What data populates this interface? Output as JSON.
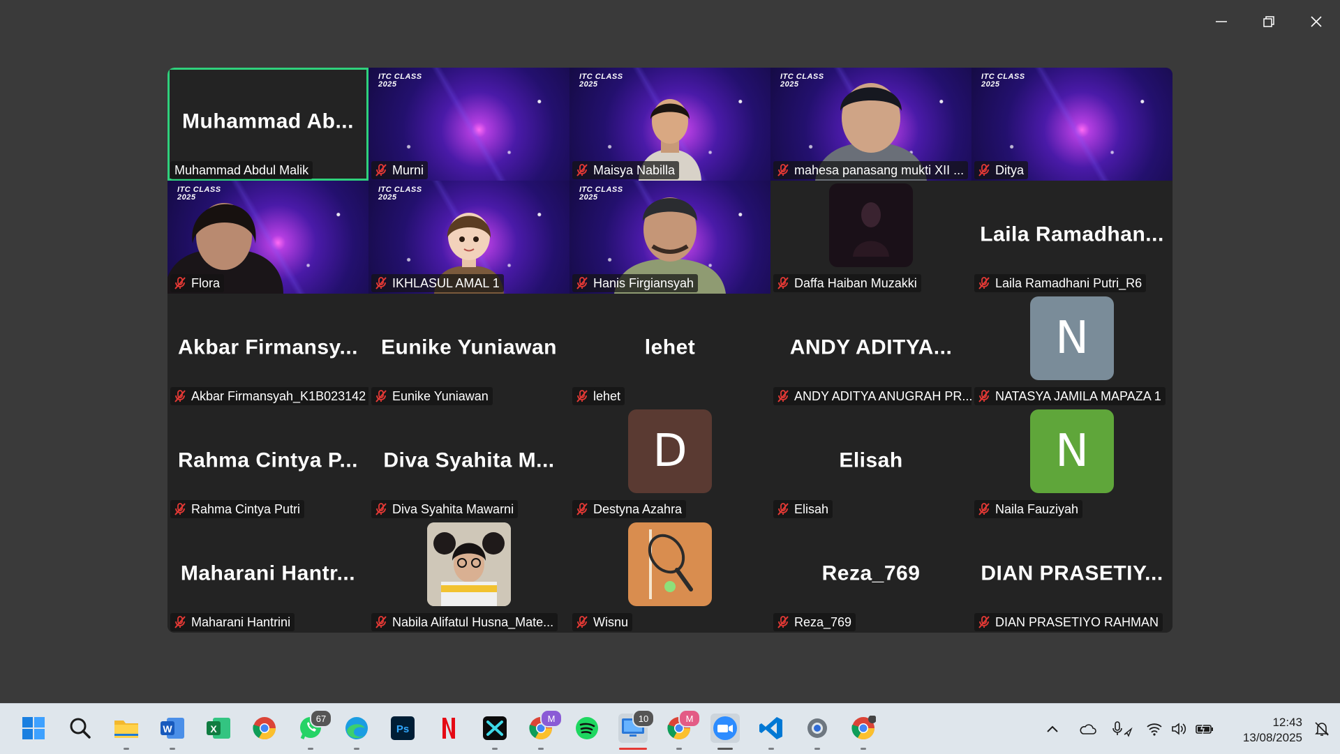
{
  "tiles": [
    {
      "display": "Muhammad  Ab...",
      "label": "Muhammad Abdul Malik",
      "muted": false,
      "active": true,
      "bg": "name"
    },
    {
      "label": "Murni",
      "muted": true,
      "bg": "itc"
    },
    {
      "label": "Maisya Nabilla",
      "muted": true,
      "bg": "itc",
      "person": "girl"
    },
    {
      "label": "mahesa panasang mukti XII ...",
      "muted": true,
      "bg": "itc",
      "person": "boy"
    },
    {
      "label": "Ditya",
      "muted": true,
      "bg": "itc"
    },
    {
      "label": "Flora",
      "muted": true,
      "bg": "itc",
      "person": "flora"
    },
    {
      "label": "IKHLASUL AMAL 1",
      "muted": true,
      "bg": "itc",
      "person": "avatar3d"
    },
    {
      "label": "Hanis Firgiansyah",
      "muted": true,
      "bg": "itc",
      "person": "man"
    },
    {
      "label": "Daffa Haiban Muzakki",
      "muted": true,
      "bg": "dark-photo"
    },
    {
      "display": "Laila  Ramadhan...",
      "label": "Laila Ramadhani Putri_R6",
      "muted": true,
      "bg": "name"
    },
    {
      "display": "Akbar  Firmansy...",
      "label": "Akbar Firmansyah_K1B023142",
      "muted": true,
      "bg": "name"
    },
    {
      "display": "Eunike Yuniawan",
      "label": "Eunike Yuniawan",
      "muted": true,
      "bg": "name"
    },
    {
      "display": "lehet",
      "label": "lehet",
      "muted": true,
      "bg": "name"
    },
    {
      "display": "ANDY  ADITYA...",
      "label": "ANDY ADITYA ANUGRAH PR...",
      "muted": true,
      "bg": "name"
    },
    {
      "letter": "N",
      "label": "NATASYA JAMILA MAPAZA 1",
      "muted": true,
      "bg": "letter",
      "color": "#7a8c99"
    },
    {
      "display": "Rahma  Cintya  P...",
      "label": "Rahma Cintya Putri",
      "muted": true,
      "bg": "name"
    },
    {
      "display": "Diva  Syahita  M...",
      "label": "Diva Syahita Mawarni",
      "muted": true,
      "bg": "name"
    },
    {
      "letter": "D",
      "label": "Destyna Azahra",
      "muted": true,
      "bg": "letter",
      "color": "#5a3a32"
    },
    {
      "display": "Elisah",
      "label": "Elisah",
      "muted": true,
      "bg": "name"
    },
    {
      "letter": "N",
      "label": "Naila Fauziyah",
      "muted": true,
      "bg": "letter",
      "color": "#5fa63a"
    },
    {
      "display": "Maharani  Hantr...",
      "label": "Maharani Hantrini",
      "muted": true,
      "bg": "name"
    },
    {
      "label": "Nabila Alifatul Husna_Mate...",
      "muted": true,
      "bg": "photo"
    },
    {
      "label": "Wisnu",
      "muted": true,
      "bg": "tennis"
    },
    {
      "display": "Reza_769",
      "label": "Reza_769",
      "muted": true,
      "bg": "name"
    },
    {
      "display": "DIAN  PRASETIY...",
      "label": "DIAN PRASETIYO RAHMAN",
      "muted": true,
      "bg": "name"
    }
  ],
  "itc_logo": [
    "ITC CLASS",
    "2025"
  ],
  "taskbar": {
    "badges": {
      "whatsapp": "67",
      "teams": "10",
      "chrome2": "M",
      "chrome3": "M"
    },
    "time": "12:43",
    "date": "13/08/2025"
  },
  "colors": {
    "active_border": "#2fd17c",
    "mute_icon": "#e53935",
    "tile_bg": "#232323",
    "window_bg": "#3a3a3a"
  }
}
